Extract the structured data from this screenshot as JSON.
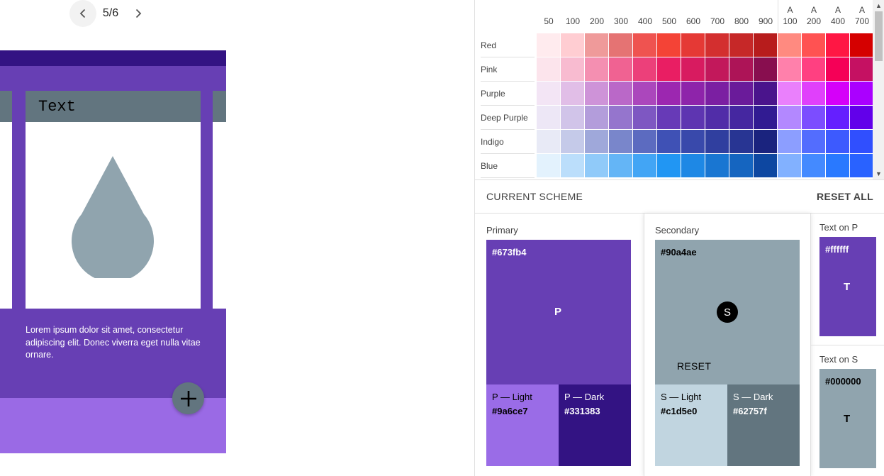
{
  "pager": {
    "label": "5/6"
  },
  "preview": {
    "card_title": "Text",
    "body_text": "Lorem ipsum dolor sit amet, consectetur adipiscing elit. Donec viverra eget nulla vitae ornare."
  },
  "palette": {
    "shades": [
      "50",
      "100",
      "200",
      "300",
      "400",
      "500",
      "600",
      "700",
      "800",
      "900"
    ],
    "accent_prefix": "A",
    "accent_shades": [
      "100",
      "200",
      "400",
      "700"
    ],
    "rows": [
      {
        "name": "Red",
        "colors": [
          "#ffebee",
          "#ffcdd2",
          "#ef9a9a",
          "#e57373",
          "#ef5350",
          "#f44336",
          "#e53935",
          "#d32f2f",
          "#c62828",
          "#b71c1c",
          "#ff8a80",
          "#ff5252",
          "#ff1744",
          "#d50000"
        ]
      },
      {
        "name": "Pink",
        "colors": [
          "#fce4ec",
          "#f8bbd0",
          "#f48fb1",
          "#f06292",
          "#ec407a",
          "#e91e63",
          "#d81b60",
          "#c2185b",
          "#ad1457",
          "#880e4f",
          "#ff80ab",
          "#ff4081",
          "#f50057",
          "#c51162"
        ]
      },
      {
        "name": "Purple",
        "colors": [
          "#f3e5f5",
          "#e1bee7",
          "#ce93d8",
          "#ba68c8",
          "#ab47bc",
          "#9c27b0",
          "#8e24aa",
          "#7b1fa2",
          "#6a1b9a",
          "#4a148c",
          "#ea80fc",
          "#e040fb",
          "#d500f9",
          "#aa00ff"
        ]
      },
      {
        "name": "Deep Purple",
        "colors": [
          "#ede7f6",
          "#d1c4e9",
          "#b39ddb",
          "#9575cd",
          "#7e57c2",
          "#673ab7",
          "#5e35b1",
          "#512da8",
          "#4527a0",
          "#311b92",
          "#b388ff",
          "#7c4dff",
          "#651fff",
          "#6200ea"
        ]
      },
      {
        "name": "Indigo",
        "colors": [
          "#e8eaf6",
          "#c5cae9",
          "#9fa8da",
          "#7986cb",
          "#5c6bc0",
          "#3f51b5",
          "#3949ab",
          "#303f9f",
          "#283593",
          "#1a237e",
          "#8c9eff",
          "#536dfe",
          "#3d5afe",
          "#304ffe"
        ]
      },
      {
        "name": "Blue",
        "colors": [
          "#e3f2fd",
          "#bbdefb",
          "#90caf9",
          "#64b5f6",
          "#42a5f5",
          "#2196f3",
          "#1e88e5",
          "#1976d2",
          "#1565c0",
          "#0d47a1",
          "#82b1ff",
          "#448aff",
          "#2979ff",
          "#2962ff"
        ]
      }
    ]
  },
  "scheme": {
    "title": "CURRENT SCHEME",
    "reset_all": "RESET ALL",
    "primary": {
      "label": "Primary",
      "hex": "#673fb4",
      "letter": "P",
      "light": {
        "name": "P — Light",
        "hex": "#9a6ce7"
      },
      "dark": {
        "name": "P — Dark",
        "hex": "#331383"
      }
    },
    "secondary": {
      "label": "Secondary",
      "hex": "#90a4ae",
      "letter": "S",
      "reset": "RESET",
      "light": {
        "name": "S — Light",
        "hex": "#c1d5e0"
      },
      "dark": {
        "name": "S — Dark",
        "hex": "#62757f"
      }
    },
    "text_on_p": {
      "label": "Text on P",
      "hex": "#ffffff",
      "letter": "T"
    },
    "text_on_s": {
      "label": "Text on S",
      "hex": "#000000",
      "letter": "T"
    }
  }
}
